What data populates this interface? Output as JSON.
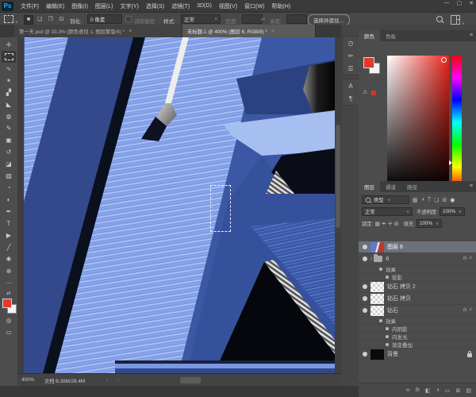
{
  "app": {
    "logo": "Ps",
    "window_controls": {
      "minimize": "—",
      "maximize": "▢",
      "close": "✕"
    }
  },
  "menu": {
    "items": [
      "文件(F)",
      "编辑(E)",
      "图像(I)",
      "图层(L)",
      "文字(Y)",
      "选择(S)",
      "滤镜(T)",
      "3D(D)",
      "视图(V)",
      "窗口(W)",
      "帮助(H)"
    ]
  },
  "options": {
    "tool_caret": "∨",
    "mode_buttons": [
      "■",
      "❏",
      "❐",
      "⊡"
    ],
    "feather_label": "羽化:",
    "feather_value": "0 像素",
    "antialias_label": "消除锯齿",
    "style_label": "样式:",
    "style_value": "正常",
    "style_caret": "∨",
    "width_label": "宽度:",
    "swap_icon": "⇄",
    "height_label": "高度:",
    "select_mask_label": "选择并遮住…",
    "workspace_caret": "∨"
  },
  "tabs": [
    {
      "label": "第一天.psd @ 33.3% (颜色查找 1, 图层蒙版/8) *",
      "close": "×"
    },
    {
      "label": "未标题-1 @ 400% (图层 6, RGB/8) *",
      "close": "×"
    }
  ],
  "toolbar": {
    "tools": [
      {
        "name": "move-tool",
        "glyph": "✛"
      },
      {
        "name": "rectangular-marquee-tool",
        "glyph": ""
      },
      {
        "name": "lasso-tool",
        "glyph": "∿"
      },
      {
        "name": "quick-selection-tool",
        "glyph": "✶"
      },
      {
        "name": "crop-tool",
        "glyph": "▞"
      },
      {
        "name": "eyedropper-tool",
        "glyph": "◣"
      },
      {
        "name": "healing-brush-tool",
        "glyph": "◍"
      },
      {
        "name": "brush-tool",
        "glyph": "✎"
      },
      {
        "name": "clone-stamp-tool",
        "glyph": "▣"
      },
      {
        "name": "history-brush-tool",
        "glyph": "↺"
      },
      {
        "name": "eraser-tool",
        "glyph": "◪"
      },
      {
        "name": "gradient-tool",
        "glyph": "▨"
      },
      {
        "name": "blur-tool",
        "glyph": "◔"
      },
      {
        "name": "dodge-tool",
        "glyph": "◐"
      },
      {
        "name": "pen-tool",
        "glyph": "✒"
      },
      {
        "name": "type-tool",
        "glyph": "T"
      },
      {
        "name": "path-selection-tool",
        "glyph": "▶"
      },
      {
        "name": "line-tool",
        "glyph": "╱"
      },
      {
        "name": "hand-tool",
        "glyph": "✱"
      },
      {
        "name": "zoom-tool",
        "glyph": "⊕"
      },
      {
        "name": "edit-toolbar",
        "glyph": "⋯"
      },
      {
        "name": "swap-colors",
        "glyph": "⇄"
      }
    ]
  },
  "dock": {
    "icons": [
      {
        "name": "history-panel",
        "glyph": "◷"
      },
      {
        "name": "brush-settings-panel",
        "glyph": "✏"
      },
      {
        "name": "properties-panel",
        "glyph": "☰"
      },
      {
        "name": "character-panel",
        "glyph": "A"
      },
      {
        "name": "paragraph-panel",
        "glyph": "¶"
      }
    ]
  },
  "color_panel": {
    "tabs": [
      "颜色",
      "色板"
    ],
    "menu_icon": "≡",
    "gamut_warning_icon": "⚠"
  },
  "layers_panel": {
    "tabs": [
      "图层",
      "通道",
      "路径"
    ],
    "menu_icon": "≡",
    "filter_label": "类型",
    "filter_caret": "∨",
    "filter_icons": [
      "▦",
      "◑",
      "T",
      "❏",
      "⊞"
    ],
    "filter_pin": "◉",
    "blend_mode": "正常",
    "blend_caret": "∨",
    "opacity_label": "不透明度:",
    "opacity_value": "100%",
    "lock_label": "锁定:",
    "lock_icons": [
      "▦",
      "✒",
      "✛",
      "⊞"
    ],
    "fill_label": "填充:",
    "fill_value": "100%",
    "rows": [
      {
        "name": "图层 6"
      },
      {
        "name": "6",
        "fx": "fx",
        "fxcaret": "˄",
        "caret": "›"
      },
      {
        "name": "效果"
      },
      {
        "name": "投影"
      },
      {
        "name": "钻石 拷贝 2"
      },
      {
        "name": "钻石 拷贝"
      },
      {
        "name": "钻石",
        "fx": "fx",
        "fxcaret": "˄"
      },
      {
        "name": "效果"
      },
      {
        "name": "内阴影"
      },
      {
        "name": "内发光"
      },
      {
        "name": "渐变叠加"
      },
      {
        "name": "背景"
      }
    ],
    "bottom_icons": [
      {
        "name": "link-layers",
        "glyph": "∞"
      },
      {
        "name": "layer-style",
        "glyph": "fx"
      },
      {
        "name": "add-layer-mask",
        "glyph": "◧"
      },
      {
        "name": "new-adjustment-layer",
        "glyph": "◑"
      },
      {
        "name": "new-group",
        "glyph": "▭"
      },
      {
        "name": "new-layer",
        "glyph": "⊞"
      },
      {
        "name": "delete-layer",
        "glyph": "▤"
      }
    ]
  },
  "status": {
    "zoom": "400%",
    "doc_info": "文档:6.39M/28.4M",
    "arrow_right": "›",
    "arrow_left": "‹"
  },
  "colors": {
    "canvas_base_blue": "#3c58a4",
    "canvas_light_band": "#7e9ce6",
    "canvas_navy": "#2c4280",
    "canvas_periwinkle": "#a6bff0",
    "canvas_black": "#05070c",
    "foreground_swatch": "#e03a2f",
    "background_swatch": "#f2f2f2"
  }
}
